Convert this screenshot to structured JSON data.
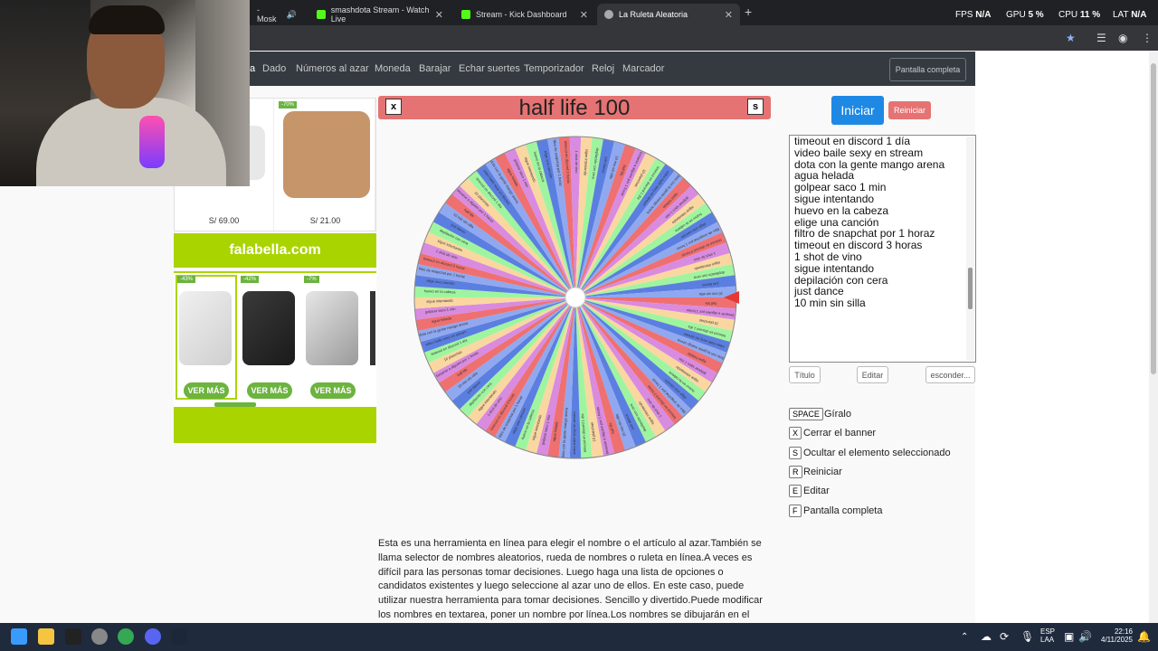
{
  "browser": {
    "tabs": [
      {
        "label": "- Mosk",
        "active": false
      },
      {
        "label": "smashdota Stream - Watch Live",
        "active": false
      },
      {
        "label": "Stream - Kick Dashboard",
        "active": false
      },
      {
        "label": "La Ruleta Aleatoria",
        "active": true
      }
    ],
    "perf": {
      "fps_label": "FPS",
      "fps_val": "N/A",
      "gpu_label": "GPU",
      "gpu_val": "5 %",
      "cpu_label": "CPU",
      "cpu_val": "11 %",
      "lat_label": "LAT",
      "lat_val": "N/A"
    }
  },
  "nav": {
    "items": [
      "a",
      "Dado",
      "Números al azar",
      "Moneda",
      "Barajar",
      "Echar suertes",
      "Temporizador",
      "Reloj",
      "Marcador"
    ],
    "fullscreen": "Pantalla completa"
  },
  "ads": {
    "products_top": [
      {
        "price": "S/ 69.00"
      },
      {
        "price": "S/ 21.00",
        "badge": "-70%"
      }
    ],
    "brand": "falabella.com",
    "products_bottom": [
      {
        "badge": "-43%",
        "cta": "VER MÁS"
      },
      {
        "badge": "-42%",
        "cta": "VER MÁS"
      },
      {
        "badge": "-7%",
        "cta": "VER MÁS"
      }
    ]
  },
  "wheel": {
    "title": "half life 100",
    "close_btn": "x",
    "s_btn": "s",
    "segment_colors": [
      "#ef7070",
      "#d98be0",
      "#fad7a0",
      "#9ff59f",
      "#5b7fe0",
      "#8fa8f0"
    ],
    "segments": 90,
    "labels": [
      "half life",
      "besarse a alguien por 1 horas",
      "10 planchas",
      "timeout en discord 1 día",
      "video baile sexy en stream",
      "dota con la gente mango arena",
      "agua helada",
      "golpear saco 1 min",
      "sigue intentando",
      "huevo en la cabeza",
      "elige una canción",
      "filtro de snapchat por 1 horaz",
      "timeout en discord 3 horas",
      "1 shot de vino",
      "sigue intentando",
      "depilación con cera",
      "just dance",
      "10 min sin silla"
    ]
  },
  "controls": {
    "start": "Iniciar",
    "reset": "Reiniciar",
    "options": [
      "timeout en discord 1 día",
      "video baile sexy en stream",
      "dota con la gente mango arena",
      "agua helada",
      "golpear saco 1 min",
      "sigue intentando",
      "huevo en la cabeza",
      "elige una canción",
      "filtro de snapchat por 1 horaz",
      "timeout en discord 3 horas",
      "1 shot de vino",
      "sigue intentando",
      "depilación con cera",
      "just dance",
      "10 min sin silla"
    ],
    "btn_title": "Título",
    "btn_edit": "Editar",
    "btn_hide": "esconder...",
    "shortcuts": [
      {
        "key": "SPACE",
        "desc": "Gíralo"
      },
      {
        "key": "X",
        "desc": "Cerrar el banner"
      },
      {
        "key": "S",
        "desc": "Ocultar el elemento seleccionado"
      },
      {
        "key": "R",
        "desc": "Reiniciar"
      },
      {
        "key": "E",
        "desc": "Editar"
      },
      {
        "key": "F",
        "desc": "Pantalla completa"
      }
    ]
  },
  "description": "Esta es una herramienta en línea para elegir el nombre o el artículo al azar.También se llama selector de nombres aleatorios, rueda de nombres o ruleta en línea.A veces es difícil para las personas tomar decisiones. Luego haga una lista de opciones o candidatos existentes y luego seleccione al azar uno de ellos. En este caso, puede utilizar nuestra herramienta para tomar decisiones. Sencillo y divertido.Puede modificar los nombres en textarea, poner un nombre por línea.Los nombres se dibujarán en el círculo.Simplemente haga clic en la rueda",
  "taskbar": {
    "lang": "ESP",
    "lang2": "LAA",
    "time": "22:16",
    "date": "4/11/2025"
  }
}
